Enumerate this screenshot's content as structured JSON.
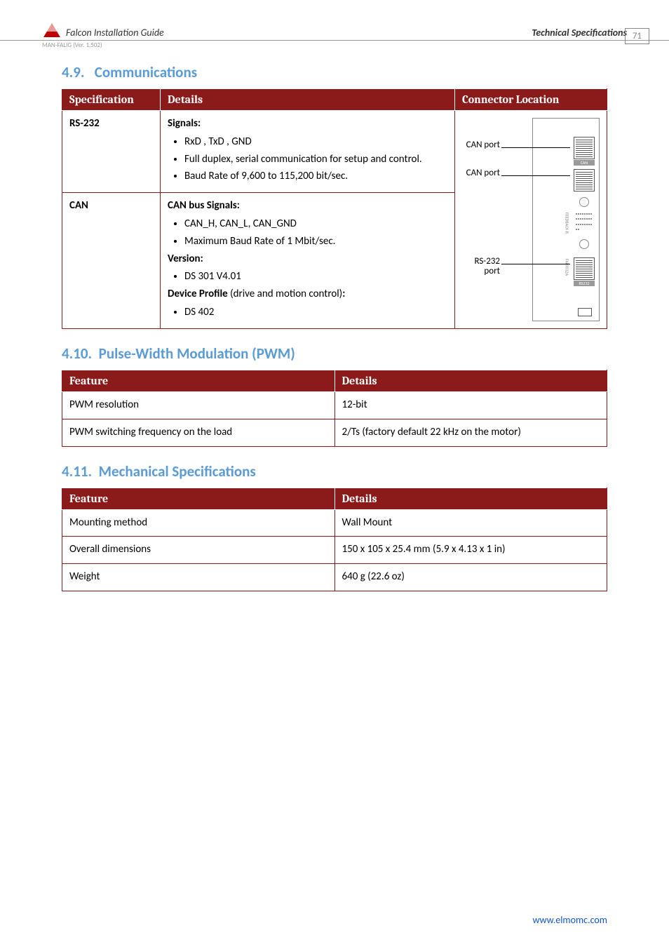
{
  "header": {
    "doc_title": "Falcon Installation Guide",
    "spec_label": "Technical Specifications",
    "version": "MAN-FALIG (Ver. 1.502)",
    "page_number": "71"
  },
  "sections": {
    "comm": {
      "num": "4.9.",
      "title": "Communications"
    },
    "pwm": {
      "num": "4.10.",
      "title": "Pulse-Width Modulation (PWM)"
    },
    "mech": {
      "num": "4.11.",
      "title": "Mechanical Specifications"
    }
  },
  "tables": {
    "comm": {
      "headers": [
        "Specification",
        "Details",
        "Connector Location"
      ],
      "rows": [
        {
          "spec": "RS-232",
          "details_lead": "Signals:",
          "bullets": [
            "RxD , TxD , GND",
            "Full duplex, serial communication for setup and control.",
            "Baud Rate of 9,600 to 115,200 bit/sec."
          ]
        },
        {
          "spec": "CAN",
          "details_lead": "CAN bus Signals:",
          "bullets": [
            "CAN_H, CAN_L, CAN_GND",
            "Maximum Baud Rate of 1 Mbit/sec."
          ],
          "version_label": "Version:",
          "version_bullets": [
            "DS 301 V4.01"
          ],
          "profile_lead_a": "Device Profile",
          "profile_lead_b": " (drive and motion control)",
          "profile_bullets": [
            "DS 402"
          ]
        }
      ],
      "diagram": {
        "can_port_a": "CAN port",
        "can_port_b": "CAN port",
        "rs232_port": "RS-232 port",
        "can_tiny": "CAN",
        "rs_tiny": "RS232",
        "side_a": "FEEDBACK B",
        "side_b": "FAL0032A"
      }
    },
    "pwm": {
      "headers": [
        "Feature",
        "Details"
      ],
      "rows": [
        {
          "feature": "PWM resolution",
          "details": "12-bit"
        },
        {
          "feature": "PWM switching frequency on the load",
          "details": "2/Ts (factory default 22 kHz on the motor)"
        }
      ]
    },
    "mech": {
      "headers": [
        "Feature",
        "Details"
      ],
      "rows": [
        {
          "feature": "Mounting method",
          "details": "Wall Mount"
        },
        {
          "feature": "Overall dimensions",
          "details": "150 x 105 x 25.4 mm (5.9 x 4.13 x 1 in)"
        },
        {
          "feature": "Weight",
          "details": "640 g (22.6 oz)"
        }
      ]
    }
  },
  "footer": {
    "url": "www.elmomc.com"
  }
}
